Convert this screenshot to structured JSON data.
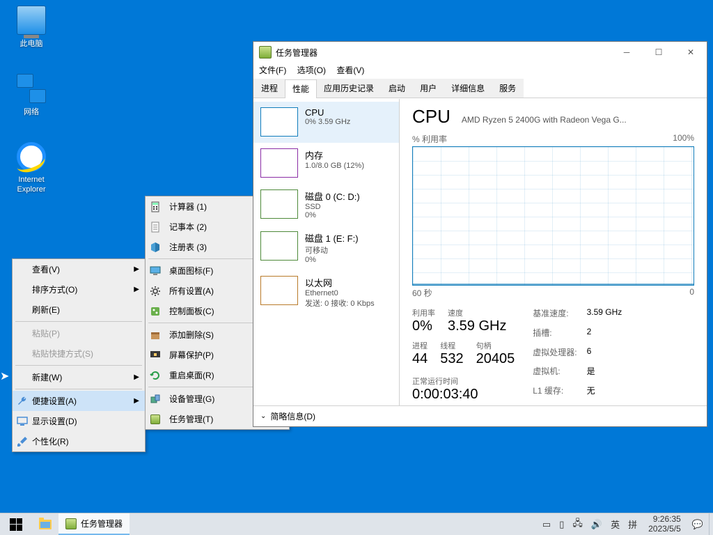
{
  "desktop_icons": {
    "pc": "此电脑",
    "net": "网络",
    "ie": "Internet Explorer"
  },
  "context_menu": {
    "view": "查看(V)",
    "sort": "排序方式(O)",
    "refresh": "刷新(E)",
    "paste": "粘贴(P)",
    "paste_shortcut": "粘贴快捷方式(S)",
    "new": "新建(W)",
    "quick_settings": "便捷设置(A)",
    "display_settings": "显示设置(D)",
    "personalize": "个性化(R)"
  },
  "submenu": {
    "calculator": "计算器  (1)",
    "notepad": "记事本  (2)",
    "regedit": "注册表  (3)",
    "desktop_icons": "桌面图标(F)",
    "all_settings": "所有设置(A)",
    "control_panel": "控制面板(C)",
    "add_remove": "添加删除(S)",
    "screen_saver": "屏幕保护(P)",
    "restart_desktop": "重启桌面(R)",
    "device_mgr": "设备管理(G)",
    "task_mgr": "任务管理(T)"
  },
  "tm": {
    "title": "任务管理器",
    "menu": {
      "file": "文件(F)",
      "options": "选项(O)",
      "view": "查看(V)"
    },
    "tabs": {
      "proc": "进程",
      "perf": "性能",
      "history": "应用历史记录",
      "startup": "启动",
      "users": "用户",
      "details": "详细信息",
      "services": "服务"
    },
    "nav": {
      "cpu": {
        "title": "CPU",
        "sub": "0% 3.59 GHz"
      },
      "mem": {
        "title": "内存",
        "sub": "1.0/8.0 GB (12%)"
      },
      "disk0": {
        "title": "磁盘 0 (C: D:)",
        "sub1": "SSD",
        "sub2": "0%"
      },
      "disk1": {
        "title": "磁盘 1 (E: F:)",
        "sub1": "可移动",
        "sub2": "0%"
      },
      "net": {
        "title": "以太网",
        "sub1": "Ethernet0",
        "sub2": "发送: 0 接收: 0 Kbps"
      }
    },
    "cpu_header": "CPU",
    "cpu_model": "AMD Ryzen 5 2400G with Radeon Vega G...",
    "axis_top_l": "% 利用率",
    "axis_top_r": "100%",
    "axis_bot_l": "60 秒",
    "axis_bot_r": "0",
    "stats": {
      "util_l": "利用率",
      "util_v": "0%",
      "speed_l": "速度",
      "speed_v": "3.59 GHz",
      "proc_l": "进程",
      "proc_v": "44",
      "thread_l": "线程",
      "thread_v": "532",
      "handle_l": "句柄",
      "handle_v": "20405"
    },
    "kv": {
      "base_l": "基准速度:",
      "base_v": "3.59 GHz",
      "sock_l": "插槽:",
      "sock_v": "2",
      "virt_l": "虚拟处理器:",
      "virt_v": "6",
      "vm_l": "虚拟机:",
      "vm_v": "是",
      "l1_l": "L1 缓存:",
      "l1_v": "无"
    },
    "uptime_l": "正常运行时间",
    "uptime_v": "0:00:03:40",
    "footer": "简略信息(D)"
  },
  "chart_data": {
    "type": "line",
    "title": "% 利用率",
    "xlabel": "60 秒 → 0",
    "ylabel": "% 利用率",
    "ylim": [
      0,
      100
    ],
    "x": [
      60,
      55,
      50,
      45,
      40,
      35,
      30,
      25,
      20,
      15,
      10,
      5,
      0
    ],
    "values": [
      0,
      0,
      0,
      0,
      0,
      0,
      0,
      0,
      0,
      0,
      0,
      0,
      0
    ]
  },
  "taskbar": {
    "task_tm": "任务管理器",
    "ime1": "英",
    "ime2": "拼",
    "time": "9:26:35",
    "date": "2023/5/5"
  }
}
